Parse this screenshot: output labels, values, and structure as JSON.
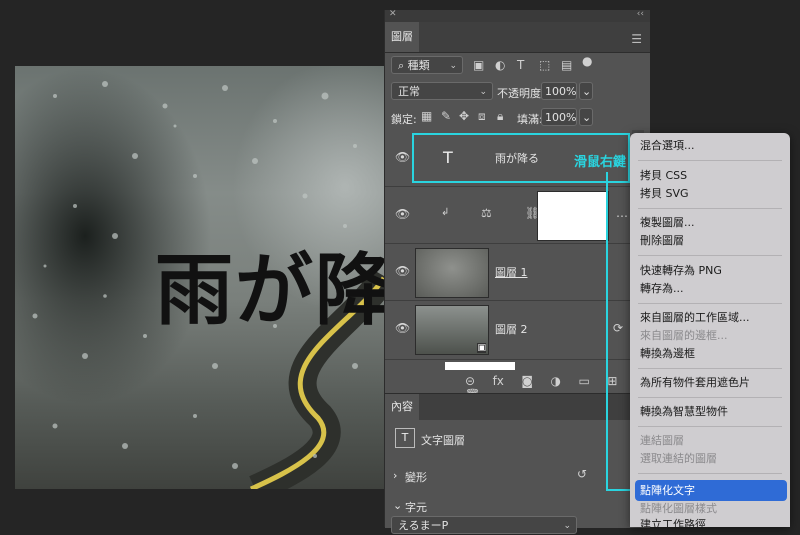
{
  "canvas": {
    "overlay_text": "雨が降"
  },
  "panel": {
    "close_glyph": "✕",
    "collapse_glyph": "‹‹",
    "tab_layers": "圖層",
    "filter_kind": "種類",
    "blend_mode": "正常",
    "opacity_label": "不透明度:",
    "opacity_value": "100%",
    "lock_label": "鎖定:",
    "fill_label": "填滿:",
    "fill_value": "100%",
    "layers": [
      {
        "name": "雨が降る",
        "thumb_glyph": "T"
      },
      {
        "name": ""
      },
      {
        "name": "圖層 1"
      },
      {
        "name": "圖層 2"
      }
    ],
    "props_tab": "內容",
    "props_text_layer": "文字圖層",
    "props_transform": "變形",
    "props_character": "字元",
    "font_value": "えるまーP"
  },
  "callout": {
    "label": "滑鼠右鍵"
  },
  "context_menu": {
    "items": [
      "混合選項...",
      "拷貝 CSS",
      "拷貝 SVG",
      "複製圖層...",
      "刪除圖層",
      "快速轉存為 PNG",
      "轉存為...",
      "來自圖層的工作區域...",
      "來自圖層的邊框...",
      "轉換為邊框",
      "為所有物件套用遮色片",
      "轉換為智慧型物件",
      "連結圖層",
      "選取連結的圖層",
      "點陣化文字",
      "點陣化圖層樣式",
      "建立工作路徑"
    ],
    "highlight_color": "#2f6bd6"
  },
  "colors": {
    "accent": "#2ad4df"
  }
}
